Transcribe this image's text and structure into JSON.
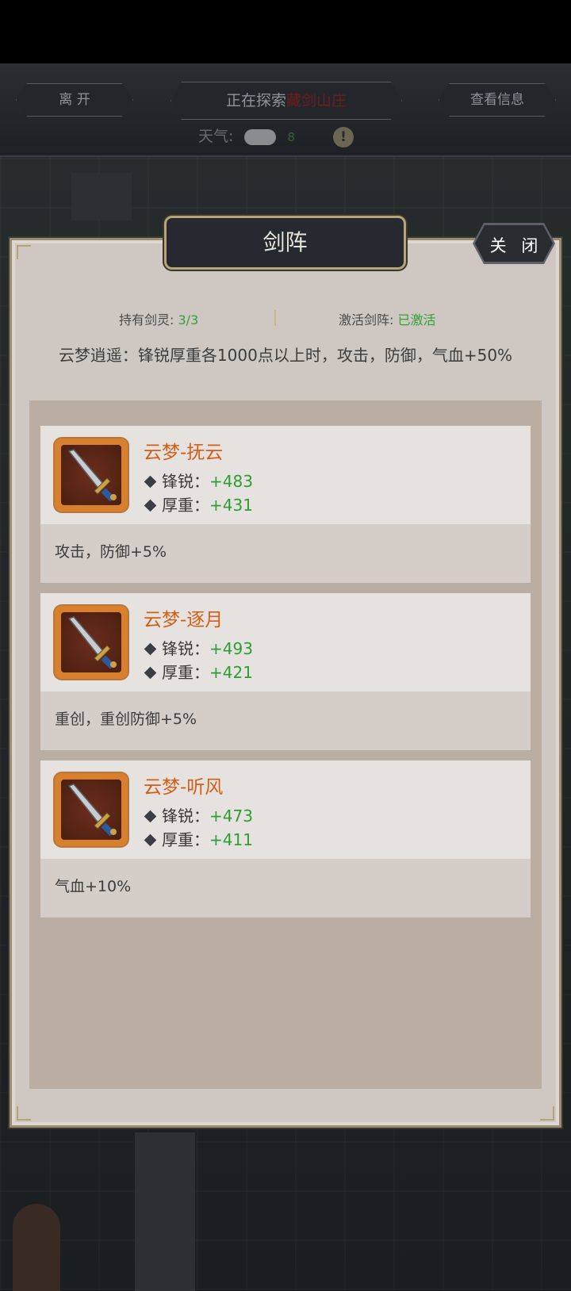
{
  "header": {
    "leave_label": "离 开",
    "explore_label": "正在探索",
    "explore_place": "藏剑山庄",
    "info_label": "查看信息",
    "weather_label": "天气:",
    "weather_value": "8"
  },
  "panel": {
    "title": "剑阵",
    "close_label": "关 闭",
    "held_label": "持有剑灵:",
    "held_value": "3/3",
    "activate_label": "激活剑阵:",
    "activate_value": "已激活",
    "description": "云梦逍遥：锋锐厚重各1000点以上时，攻击，防御，气血+50%"
  },
  "cards": [
    {
      "name": "云梦-抚云",
      "attrs": [
        {
          "label": "锋锐：",
          "value": "+483"
        },
        {
          "label": "厚重：",
          "value": "+431"
        }
      ],
      "bonus": "攻击，防御+5%"
    },
    {
      "name": "云梦-逐月",
      "attrs": [
        {
          "label": "锋锐：",
          "value": "+493"
        },
        {
          "label": "厚重：",
          "value": "+421"
        }
      ],
      "bonus": "重创，重创防御+5%"
    },
    {
      "name": "云梦-听风",
      "attrs": [
        {
          "label": "锋锐：",
          "value": "+473"
        },
        {
          "label": "厚重：",
          "value": "+411"
        }
      ],
      "bonus": "气血+10%"
    }
  ],
  "colors": {
    "accent_orange": "#d35e18",
    "value_green": "#2f9c34",
    "panel_bg": "#cfc8c2"
  }
}
